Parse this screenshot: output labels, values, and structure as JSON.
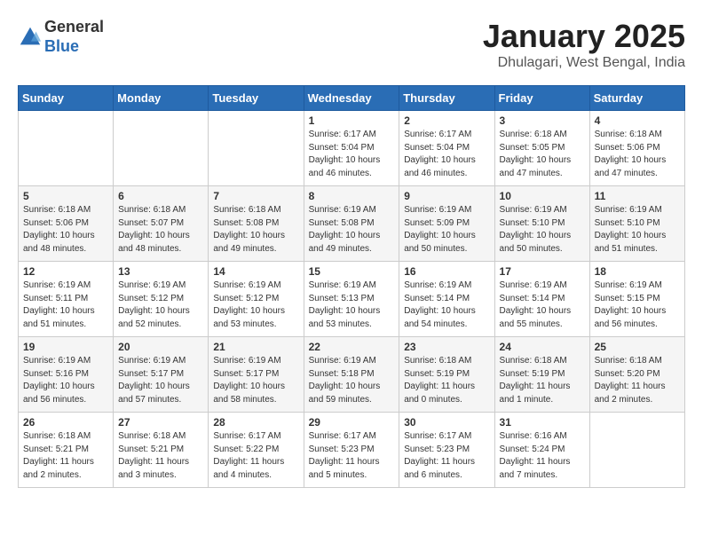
{
  "logo": {
    "general": "General",
    "blue": "Blue"
  },
  "title": "January 2025",
  "subtitle": "Dhulagari, West Bengal, India",
  "days_header": [
    "Sunday",
    "Monday",
    "Tuesday",
    "Wednesday",
    "Thursday",
    "Friday",
    "Saturday"
  ],
  "weeks": [
    [
      {
        "day": "",
        "details": ""
      },
      {
        "day": "",
        "details": ""
      },
      {
        "day": "",
        "details": ""
      },
      {
        "day": "1",
        "details": "Sunrise: 6:17 AM\nSunset: 5:04 PM\nDaylight: 10 hours\nand 46 minutes."
      },
      {
        "day": "2",
        "details": "Sunrise: 6:17 AM\nSunset: 5:04 PM\nDaylight: 10 hours\nand 46 minutes."
      },
      {
        "day": "3",
        "details": "Sunrise: 6:18 AM\nSunset: 5:05 PM\nDaylight: 10 hours\nand 47 minutes."
      },
      {
        "day": "4",
        "details": "Sunrise: 6:18 AM\nSunset: 5:06 PM\nDaylight: 10 hours\nand 47 minutes."
      }
    ],
    [
      {
        "day": "5",
        "details": "Sunrise: 6:18 AM\nSunset: 5:06 PM\nDaylight: 10 hours\nand 48 minutes."
      },
      {
        "day": "6",
        "details": "Sunrise: 6:18 AM\nSunset: 5:07 PM\nDaylight: 10 hours\nand 48 minutes."
      },
      {
        "day": "7",
        "details": "Sunrise: 6:18 AM\nSunset: 5:08 PM\nDaylight: 10 hours\nand 49 minutes."
      },
      {
        "day": "8",
        "details": "Sunrise: 6:19 AM\nSunset: 5:08 PM\nDaylight: 10 hours\nand 49 minutes."
      },
      {
        "day": "9",
        "details": "Sunrise: 6:19 AM\nSunset: 5:09 PM\nDaylight: 10 hours\nand 50 minutes."
      },
      {
        "day": "10",
        "details": "Sunrise: 6:19 AM\nSunset: 5:10 PM\nDaylight: 10 hours\nand 50 minutes."
      },
      {
        "day": "11",
        "details": "Sunrise: 6:19 AM\nSunset: 5:10 PM\nDaylight: 10 hours\nand 51 minutes."
      }
    ],
    [
      {
        "day": "12",
        "details": "Sunrise: 6:19 AM\nSunset: 5:11 PM\nDaylight: 10 hours\nand 51 minutes."
      },
      {
        "day": "13",
        "details": "Sunrise: 6:19 AM\nSunset: 5:12 PM\nDaylight: 10 hours\nand 52 minutes."
      },
      {
        "day": "14",
        "details": "Sunrise: 6:19 AM\nSunset: 5:12 PM\nDaylight: 10 hours\nand 53 minutes."
      },
      {
        "day": "15",
        "details": "Sunrise: 6:19 AM\nSunset: 5:13 PM\nDaylight: 10 hours\nand 53 minutes."
      },
      {
        "day": "16",
        "details": "Sunrise: 6:19 AM\nSunset: 5:14 PM\nDaylight: 10 hours\nand 54 minutes."
      },
      {
        "day": "17",
        "details": "Sunrise: 6:19 AM\nSunset: 5:14 PM\nDaylight: 10 hours\nand 55 minutes."
      },
      {
        "day": "18",
        "details": "Sunrise: 6:19 AM\nSunset: 5:15 PM\nDaylight: 10 hours\nand 56 minutes."
      }
    ],
    [
      {
        "day": "19",
        "details": "Sunrise: 6:19 AM\nSunset: 5:16 PM\nDaylight: 10 hours\nand 56 minutes."
      },
      {
        "day": "20",
        "details": "Sunrise: 6:19 AM\nSunset: 5:17 PM\nDaylight: 10 hours\nand 57 minutes."
      },
      {
        "day": "21",
        "details": "Sunrise: 6:19 AM\nSunset: 5:17 PM\nDaylight: 10 hours\nand 58 minutes."
      },
      {
        "day": "22",
        "details": "Sunrise: 6:19 AM\nSunset: 5:18 PM\nDaylight: 10 hours\nand 59 minutes."
      },
      {
        "day": "23",
        "details": "Sunrise: 6:18 AM\nSunset: 5:19 PM\nDaylight: 11 hours\nand 0 minutes."
      },
      {
        "day": "24",
        "details": "Sunrise: 6:18 AM\nSunset: 5:19 PM\nDaylight: 11 hours\nand 1 minute."
      },
      {
        "day": "25",
        "details": "Sunrise: 6:18 AM\nSunset: 5:20 PM\nDaylight: 11 hours\nand 2 minutes."
      }
    ],
    [
      {
        "day": "26",
        "details": "Sunrise: 6:18 AM\nSunset: 5:21 PM\nDaylight: 11 hours\nand 2 minutes."
      },
      {
        "day": "27",
        "details": "Sunrise: 6:18 AM\nSunset: 5:21 PM\nDaylight: 11 hours\nand 3 minutes."
      },
      {
        "day": "28",
        "details": "Sunrise: 6:17 AM\nSunset: 5:22 PM\nDaylight: 11 hours\nand 4 minutes."
      },
      {
        "day": "29",
        "details": "Sunrise: 6:17 AM\nSunset: 5:23 PM\nDaylight: 11 hours\nand 5 minutes."
      },
      {
        "day": "30",
        "details": "Sunrise: 6:17 AM\nSunset: 5:23 PM\nDaylight: 11 hours\nand 6 minutes."
      },
      {
        "day": "31",
        "details": "Sunrise: 6:16 AM\nSunset: 5:24 PM\nDaylight: 11 hours\nand 7 minutes."
      },
      {
        "day": "",
        "details": ""
      }
    ]
  ]
}
